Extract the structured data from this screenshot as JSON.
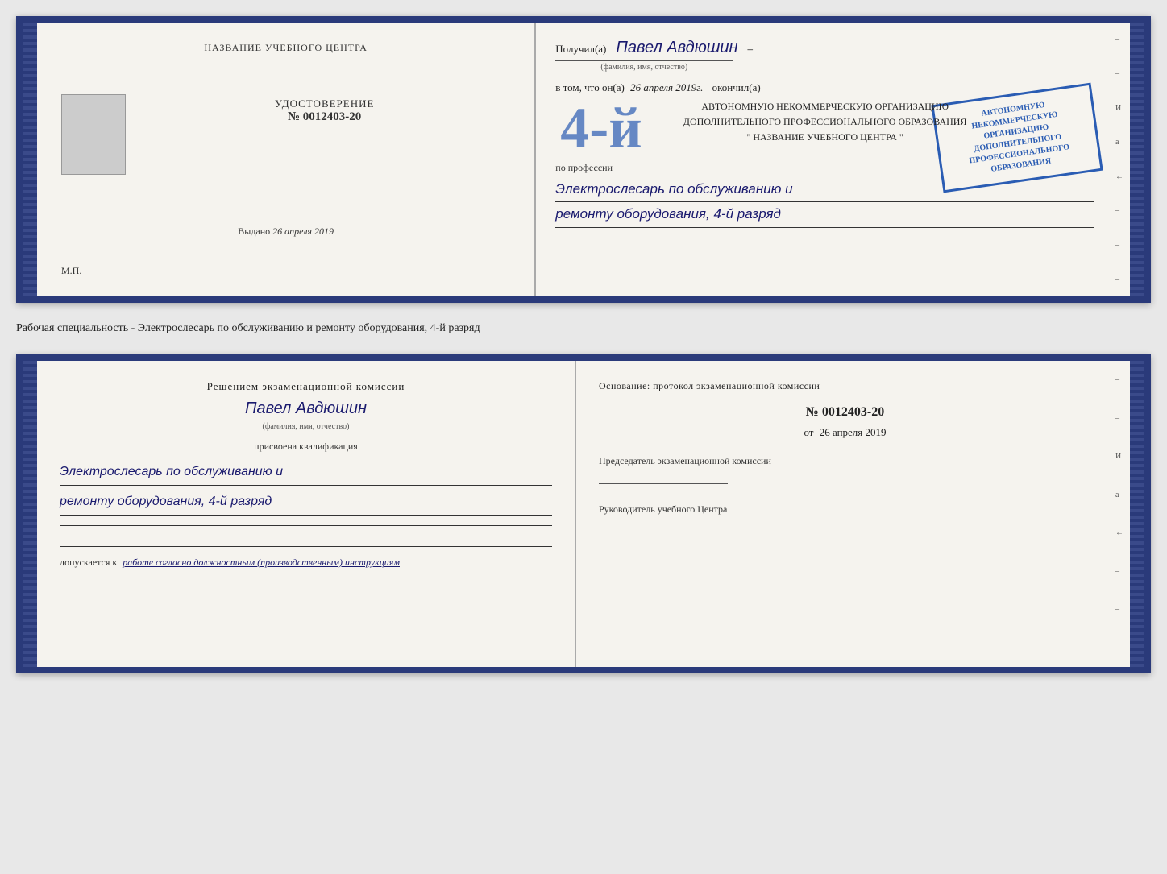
{
  "top_document": {
    "left_page": {
      "center_title": "НАЗВАНИЕ УЧЕБНОГО ЦЕНТРА",
      "cert_title": "УДОСТОВЕРЕНИЕ",
      "cert_number": "№ 0012403-20",
      "issued_label": "Выдано",
      "issued_date": "26 апреля 2019",
      "mp_label": "М.П."
    },
    "right_page": {
      "received_label": "Получил(а)",
      "recipient_name": "Павел Авдюшин",
      "fio_label": "(фамилия, имя, отчество)",
      "vtom_label": "в том, что он(а)",
      "vtom_date": "26 апреля 2019г.",
      "okonchil_label": "окончил(а)",
      "big_number": "4-й",
      "org_line1": "АВТОНОМНУЮ НЕКОММЕРЧЕСКУЮ ОРГАНИЗАЦИЮ",
      "org_line2": "ДОПОЛНИТЕЛЬНОГО ПРОФЕССИОНАЛЬНОГО ОБРАЗОВАНИЯ",
      "org_line3": "\" НАЗВАНИЕ УЧЕБНОГО ЦЕНТРА \"",
      "profession_label": "по профессии",
      "profession_line1": "Электрослесарь по обслуживанию и",
      "profession_line2": "ремонту оборудования, 4-й разряд",
      "stamp_line1": "АВТОНОМНУЮ НЕКОММЕРЧЕСКУЮ",
      "stamp_line2": "ОРГАНИЗАЦИЮ",
      "stamp_line3": "ДОПОЛНИТЕЛЬНОГО",
      "stamp_line4": "ПРОФЕССИОНАЛЬНОГО",
      "stamp_line5": "ОБРАЗОВАНИЯ"
    }
  },
  "separator": {
    "text": "Рабочая специальность - Электрослесарь по обслуживанию и ремонту оборудования, 4-й разряд"
  },
  "bottom_document": {
    "left_page": {
      "komissia_title": "Решением экзаменационной комиссии",
      "person_name": "Павел Авдюшин",
      "fio_label": "(фамилия, имя, отчество)",
      "prisvoena_label": "присвоена квалификация",
      "kvalif_line1": "Электрослесарь по обслуживанию и",
      "kvalif_line2": "ремонту оборудования, 4-й разряд",
      "dopusk_label": "допускается к",
      "dopusk_value": "работе согласно должностным (производственным) инструкциям"
    },
    "right_page": {
      "osnov_label": "Основание: протокол экзаменационной комиссии",
      "number_label": "№ 0012403-20",
      "date_prefix": "от",
      "date_value": "26 апреля 2019",
      "chair_label": "Председатель экзаменационной комиссии",
      "rukov_label": "Руководитель учебного Центра"
    }
  },
  "side_chars": {
    "chars": [
      "И",
      "а",
      "←",
      "–",
      "–",
      "–",
      "–",
      "–"
    ]
  }
}
